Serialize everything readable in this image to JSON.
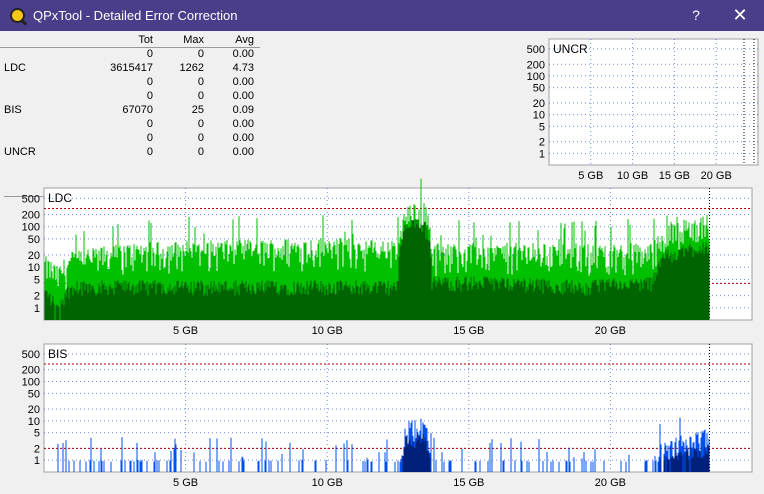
{
  "window": {
    "title": "QPxTool - Detailed Error Correction",
    "help_label": "?",
    "close_label": "✕"
  },
  "stats": {
    "headers": [
      "",
      "Tot",
      "Max",
      "Avg"
    ],
    "rows": [
      {
        "name": "",
        "tot": "0",
        "max": "0",
        "avg": "0.00"
      },
      {
        "name": "LDC",
        "tot": "3615417",
        "max": "1262",
        "avg": "4.73"
      },
      {
        "name": "",
        "tot": "0",
        "max": "0",
        "avg": "0.00"
      },
      {
        "name": "",
        "tot": "0",
        "max": "0",
        "avg": "0.00"
      },
      {
        "name": "BIS",
        "tot": "67070",
        "max": "25",
        "avg": "0.09"
      },
      {
        "name": "",
        "tot": "0",
        "max": "0",
        "avg": "0.00"
      },
      {
        "name": "",
        "tot": "0",
        "max": "0",
        "avg": "0.00"
      },
      {
        "name": "UNCR",
        "tot": "0",
        "max": "0",
        "avg": "0.00"
      }
    ]
  },
  "colors": {
    "ldc_light": "#00c000",
    "ldc_dark": "#006400",
    "bis_light": "#0050f0",
    "bis_dark": "#00207a",
    "limit_line": "#b00000"
  },
  "chart_data": [
    {
      "type": "area",
      "title": "UNCR",
      "y_scale": "log",
      "y_ticks": [
        1,
        2,
        5,
        10,
        20,
        50,
        100,
        200,
        500
      ],
      "x_ticks": [
        5,
        10,
        15,
        20
      ],
      "x_tick_labels": [
        "5 GB",
        "10 GB",
        "15 GB",
        "20 GB"
      ],
      "x_range": [
        0,
        25
      ],
      "series": []
    },
    {
      "type": "area",
      "title": "LDC",
      "y_scale": "log",
      "y_ticks": [
        1,
        2,
        5,
        10,
        20,
        50,
        100,
        200,
        500
      ],
      "x_ticks": [
        5,
        10,
        15,
        20
      ],
      "x_tick_labels": [
        "5 GB",
        "10 GB",
        "15 GB",
        "20 GB"
      ],
      "x_range": [
        0,
        25
      ],
      "limit_lines": [
        280,
        4
      ],
      "end_marker": 23.5,
      "profile": [
        {
          "x": 0.0,
          "dark": 3,
          "light": 20
        },
        {
          "x": 0.5,
          "dark": 1,
          "light": 10
        },
        {
          "x": 1.0,
          "dark": 4,
          "light": 25
        },
        {
          "x": 3.0,
          "dark": 4,
          "light": 40
        },
        {
          "x": 5.0,
          "dark": 4,
          "light": 45
        },
        {
          "x": 8.0,
          "dark": 4,
          "light": 50
        },
        {
          "x": 10.0,
          "dark": 4,
          "light": 55
        },
        {
          "x": 12.5,
          "dark": 4,
          "light": 45
        },
        {
          "x": 12.8,
          "dark": 120,
          "light": 300
        },
        {
          "x": 13.4,
          "dark": 140,
          "light": 500
        },
        {
          "x": 13.7,
          "dark": 5,
          "light": 40
        },
        {
          "x": 16.0,
          "dark": 5,
          "light": 40
        },
        {
          "x": 19.0,
          "dark": 4,
          "light": 40
        },
        {
          "x": 21.5,
          "dark": 5,
          "light": 40
        },
        {
          "x": 21.8,
          "dark": 20,
          "light": 100
        },
        {
          "x": 23.3,
          "dark": 40,
          "light": 200
        },
        {
          "x": 23.5,
          "dark": 40,
          "light": 200
        }
      ]
    },
    {
      "type": "area",
      "title": "BIS",
      "y_scale": "log",
      "y_ticks": [
        1,
        2,
        5,
        10,
        20,
        50,
        100,
        200,
        500
      ],
      "x_ticks": [
        5,
        10,
        15,
        20
      ],
      "x_tick_labels": [
        "5 GB",
        "10 GB",
        "15 GB",
        "20 GB"
      ],
      "x_range": [
        0,
        25
      ],
      "limit_lines": [
        280,
        2
      ],
      "end_marker": 23.5,
      "profile": [
        {
          "x": 0.0,
          "dark": 0.3,
          "light": 1
        },
        {
          "x": 3.0,
          "dark": 0.3,
          "light": 1
        },
        {
          "x": 10.0,
          "dark": 0.3,
          "light": 1
        },
        {
          "x": 12.6,
          "dark": 0.3,
          "light": 1
        },
        {
          "x": 12.8,
          "dark": 4,
          "light": 10
        },
        {
          "x": 13.4,
          "dark": 4,
          "light": 12
        },
        {
          "x": 13.7,
          "dark": 0.3,
          "light": 1
        },
        {
          "x": 21.5,
          "dark": 0.3,
          "light": 1
        },
        {
          "x": 21.8,
          "dark": 1,
          "light": 3
        },
        {
          "x": 23.3,
          "dark": 2,
          "light": 6
        },
        {
          "x": 23.5,
          "dark": 2,
          "light": 6
        }
      ]
    }
  ]
}
